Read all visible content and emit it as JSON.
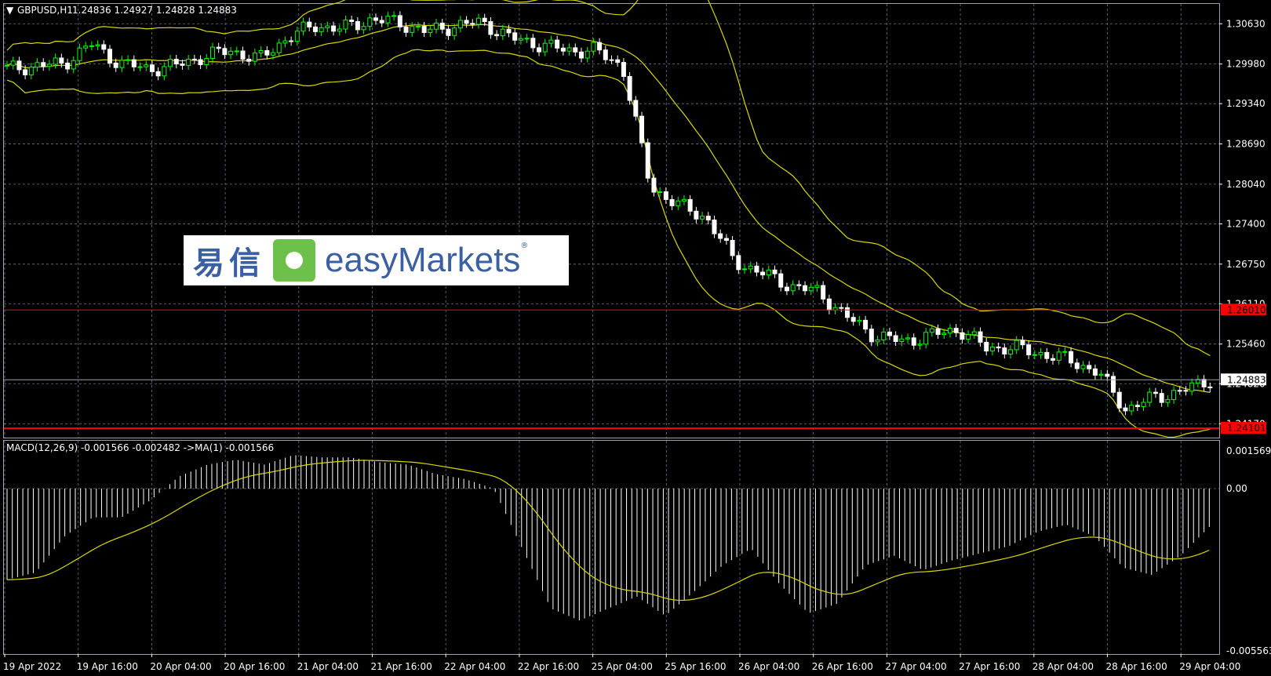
{
  "header": {
    "symbol": "GBPUSD,H1",
    "ohlc": "1.24836 1.24927 1.24828 1.24883"
  },
  "macd_header": "MACD(12,26,9) -0.001566 -0.002482 ->MA(1) -0.001566",
  "price_axis": [
    "1.30630",
    "1.29980",
    "1.29340",
    "1.28690",
    "1.28040",
    "1.27400",
    "1.26750",
    "1.26110",
    "1.25460",
    "1.24820",
    "1.24170"
  ],
  "price_levels": {
    "red_top": "1.26010",
    "current": "1.24883",
    "red_bottom": "1.24101"
  },
  "macd_axis": [
    "0.001569",
    "0.00",
    "-0.005563"
  ],
  "time_axis": [
    "19 Apr 2022",
    "19 Apr 16:00",
    "20 Apr 04:00",
    "20 Apr 16:00",
    "21 Apr 04:00",
    "21 Apr 16:00",
    "22 Apr 04:00",
    "22 Apr 16:00",
    "25 Apr 04:00",
    "25 Apr 16:00",
    "26 Apr 04:00",
    "26 Apr 16:00",
    "27 Apr 04:00",
    "27 Apr 16:00",
    "28 Apr 04:00",
    "28 Apr 16:00",
    "29 Apr 04:00"
  ],
  "logo": {
    "cn": "易信",
    "en": "easyMarkets",
    "reg": "®"
  },
  "colors": {
    "bull": "#00ff00",
    "bear": "#ffffff",
    "bands": "#d9d900",
    "grid": "#6b7580",
    "red": "#ff0000"
  },
  "chart_data": {
    "type": "candlestick",
    "price_close_path": [
      1.299,
      1.2995,
      1.2998,
      1.303,
      1.3,
      1.299,
      1.2995,
      1.301,
      1.302,
      1.3005,
      1.304,
      1.306,
      1.3055,
      1.307,
      1.3065,
      1.305,
      1.306,
      1.3065,
      1.304,
      1.303,
      1.302,
      1.302,
      1.2995,
      1.28,
      1.277,
      1.275,
      1.268,
      1.266,
      1.264,
      1.263,
      1.259,
      1.256,
      1.255,
      1.256,
      1.257,
      1.254,
      1.254,
      1.253,
      1.252,
      1.25,
      1.244,
      1.246,
      1.247,
      1.2488
    ],
    "macd_hist": [
      -0.0038,
      -0.0035,
      -0.002,
      -0.0012,
      -0.0012,
      -0.0005,
      0.0005,
      0.001,
      0.0012,
      0.001,
      0.0014,
      0.0013,
      0.0013,
      0.0011,
      0.001,
      0.0006,
      0.0004,
      0.0,
      -0.0025,
      -0.005,
      -0.0055,
      -0.005,
      -0.0045,
      -0.0053,
      -0.0043,
      -0.0032,
      -0.0025,
      -0.004,
      -0.0052,
      -0.0048,
      -0.0032,
      -0.0028,
      -0.0034,
      -0.003,
      -0.0027,
      -0.0024,
      -0.0018,
      -0.0015,
      -0.002,
      -0.0033,
      -0.0036,
      -0.0028,
      -0.0016
    ]
  }
}
